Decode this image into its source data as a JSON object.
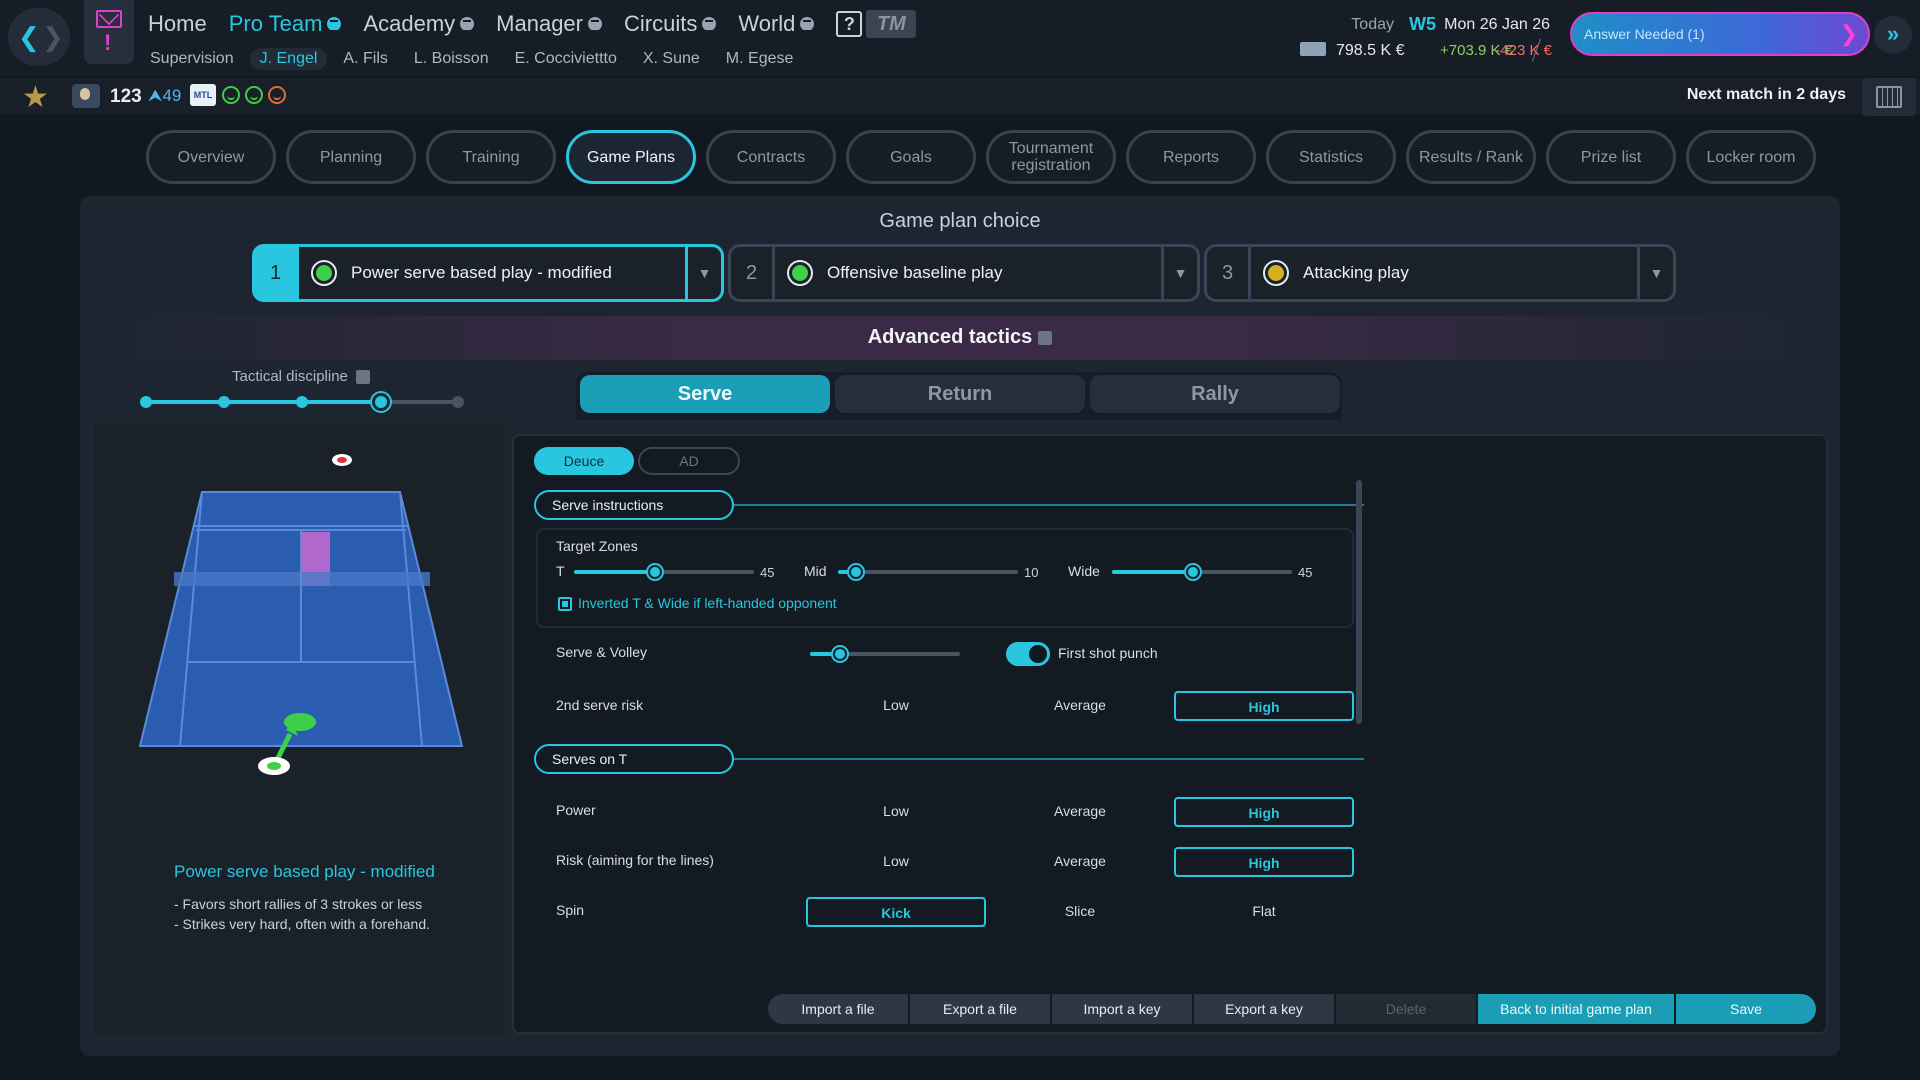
{
  "topbar": {
    "main_nav": [
      {
        "label": "Home",
        "menu": false
      },
      {
        "label": "Pro Team",
        "menu": true
      },
      {
        "label": "Academy",
        "menu": true
      },
      {
        "label": "Manager",
        "menu": true
      },
      {
        "label": "Circuits",
        "menu": true
      },
      {
        "label": "World",
        "menu": true
      }
    ],
    "help": "?",
    "logo": "TM",
    "sub_nav": [
      "Supervision",
      "J. Engel",
      "A. Fils",
      "L. Boisson",
      "E. Cocciviettto",
      "X. Sune",
      "M. Egese"
    ],
    "today_label": "Today",
    "week": "W5",
    "date": "Mon 26 Jan 26",
    "balance": "798.5 K €",
    "income": "+703.9 K €",
    "expense": "-423 K €",
    "answer_needed": "Answer Needed (1)"
  },
  "status": {
    "ranking": "123",
    "ranking_up": "49",
    "mtl": "MTL",
    "next_match": "Next match in 2 days"
  },
  "tabs": [
    "Overview",
    "Planning",
    "Training",
    "Game Plans",
    "Contracts",
    "Goals",
    "Tournament registration",
    "Reports",
    "Statistics",
    "Results / Rank",
    "Prize list",
    "Locker room"
  ],
  "game_plan": {
    "title": "Game plan choice",
    "slots": [
      {
        "num": "1",
        "label": "Power serve based play - modified"
      },
      {
        "num": "2",
        "label": "Offensive baseline play"
      },
      {
        "num": "3",
        "label": "Attacking play"
      }
    ],
    "advanced_tactics": "Advanced tactics",
    "tactical_discipline": "Tactical discipline",
    "discipline_level": 0.75
  },
  "serve_tabs": [
    "Serve",
    "Return",
    "Rally"
  ],
  "side_toggle": {
    "deuce": "Deuce",
    "ad": "AD"
  },
  "serve_instructions": {
    "title": "Serve instructions",
    "target_zones": "Target Zones",
    "zones": [
      {
        "name": "T",
        "value": "45",
        "level": 0.45
      },
      {
        "name": "Mid",
        "value": "10",
        "level": 0.1
      },
      {
        "name": "Wide",
        "value": "45",
        "level": 0.45
      }
    ],
    "inverted": "Inverted T & Wide if left-handed opponent",
    "serve_volley": "Serve & Volley",
    "serve_volley_level": 0.2,
    "first_shot_punch": "First shot punch",
    "second_serve_risk": "2nd serve risk",
    "options_lma": [
      "Low",
      "Average",
      "High"
    ]
  },
  "serves_on_t": {
    "title": "Serves on T",
    "power": "Power",
    "risk": "Risk (aiming for the lines)",
    "spin": "Spin",
    "spin_options": [
      "Kick",
      "Slice",
      "Flat"
    ]
  },
  "plan_summary": {
    "name": "Power serve based play - modified",
    "desc1": "- Favors short rallies of 3 strokes or less",
    "desc2": "- Strikes very hard, often with a forehand."
  },
  "buttons": {
    "import_file": "Import a file",
    "export_file": "Export a file",
    "import_key": "Import a key",
    "export_key": "Export a key",
    "delete": "Delete",
    "back": "Back to initial game plan",
    "save": "Save"
  },
  "colors": {
    "accent": "#29c6e0",
    "alert": "#e040c8",
    "court": "#2a5cb0"
  }
}
